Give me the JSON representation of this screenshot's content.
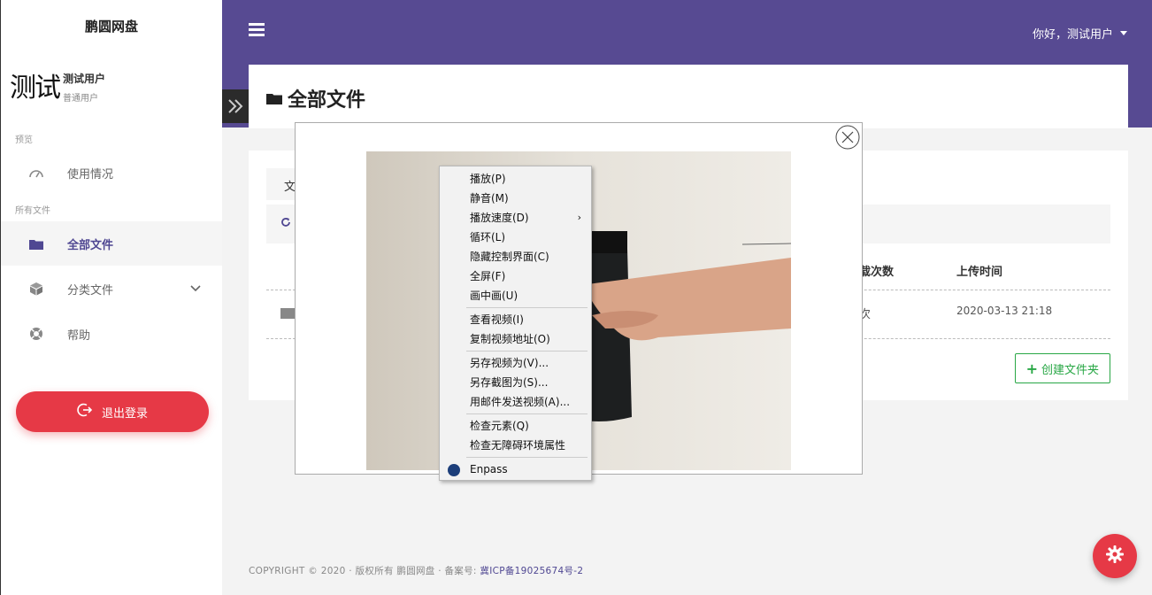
{
  "sidebar": {
    "brand": "鹏圆网盘",
    "avatar_text": "测试",
    "user_name": "测试用户",
    "user_role": "普通用户",
    "section_preview": "预览",
    "section_files": "所有文件",
    "items": [
      {
        "label": "使用情况",
        "icon": "gauge-icon"
      },
      {
        "label": "全部文件",
        "icon": "folder-icon"
      },
      {
        "label": "分类文件",
        "icon": "cube-icon"
      },
      {
        "label": "帮助",
        "icon": "lifebuoy-icon"
      }
    ],
    "logout_label": "退出登录"
  },
  "header": {
    "greeting": "你好，测试用户"
  },
  "main": {
    "title": "全部文件",
    "tab_label": "文",
    "columns": [
      "载次数",
      "上传时间"
    ],
    "rows": [
      {
        "downloads": "次",
        "uploaded": "2020-03-13 21:18"
      }
    ],
    "create_folder": "创建文件夹"
  },
  "context_menu": {
    "items": [
      "播放(P)",
      "静音(M)",
      "播放速度(D)",
      "循环(L)",
      "隐藏控制界面(C)",
      "全屏(F)",
      "画中画(U)",
      "查看视频(I)",
      "复制视频地址(O)",
      "另存视频为(V)...",
      "另存截图为(S)...",
      "用邮件发送视频(A)...",
      "检查元素(Q)",
      "检查无障碍环境属性",
      "Enpass"
    ]
  },
  "footer": {
    "copyright": "COPYRIGHT © 2020 · 版权所有 鹏圆网盘 · 备案号: ",
    "icp": "冀ICP备19025674号-2"
  },
  "colors": {
    "header": "#574a92",
    "accent": "#4f4792",
    "danger": "#e63946",
    "success": "#28a745"
  }
}
